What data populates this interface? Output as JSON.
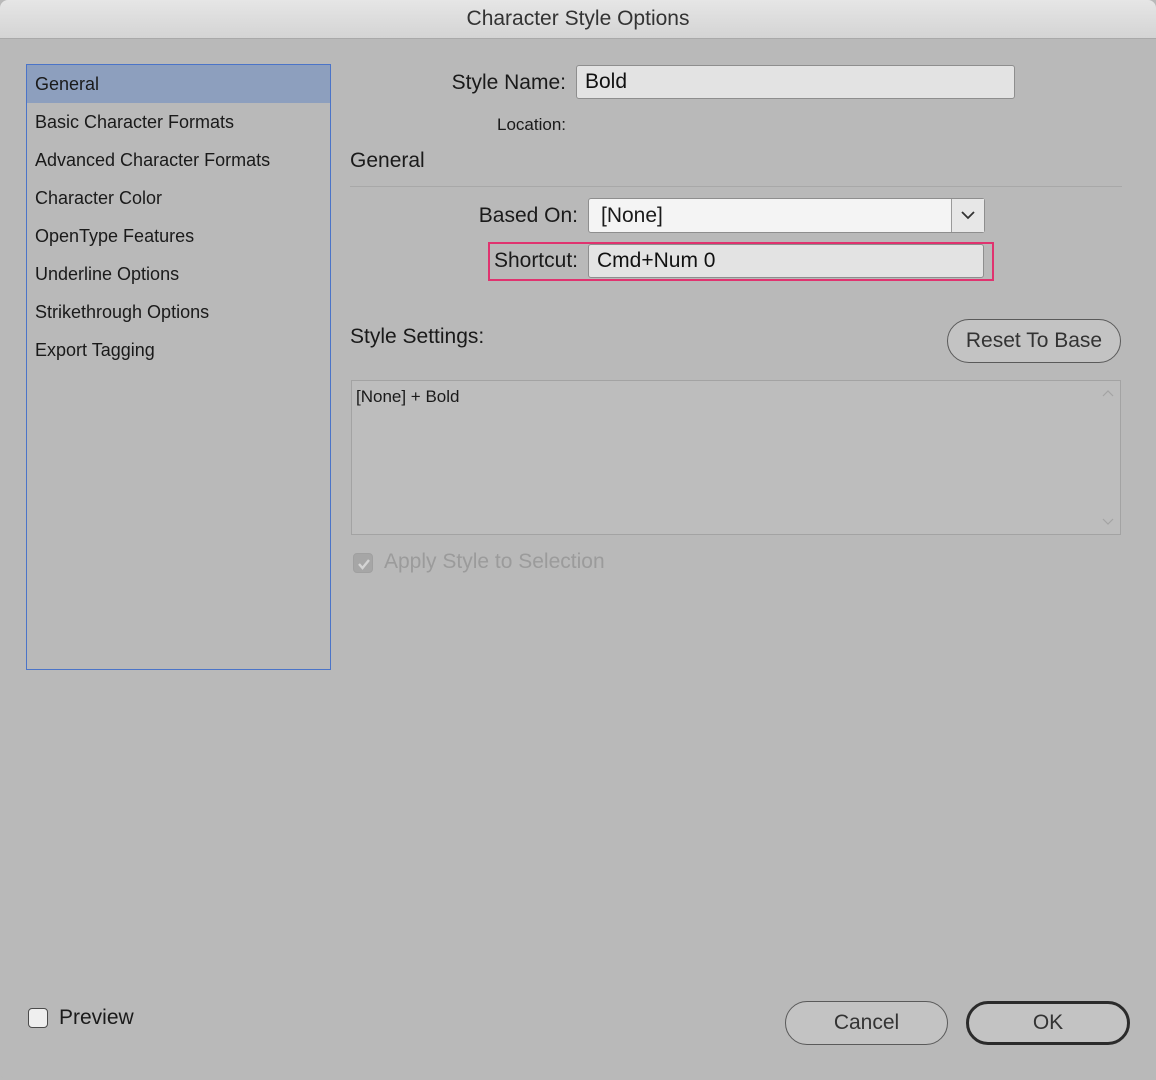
{
  "window": {
    "title": "Character Style Options"
  },
  "sidebar": {
    "items": [
      {
        "label": "General",
        "selected": true
      },
      {
        "label": "Basic Character Formats"
      },
      {
        "label": "Advanced Character Formats"
      },
      {
        "label": "Character Color"
      },
      {
        "label": "OpenType Features"
      },
      {
        "label": "Underline Options"
      },
      {
        "label": "Strikethrough Options"
      },
      {
        "label": "Export Tagging"
      }
    ]
  },
  "form": {
    "style_name_label": "Style Name:",
    "style_name_value": "Bold",
    "location_label": "Location:",
    "section_title": "General",
    "based_on_label": "Based On:",
    "based_on_value": "[None]",
    "shortcut_label": "Shortcut:",
    "shortcut_value": "Cmd+Num 0",
    "style_settings_label": "Style Settings:",
    "reset_button": "Reset To Base",
    "style_settings_text": "[None] + Bold",
    "apply_style_label": "Apply Style to Selection",
    "apply_style_checked": true
  },
  "footer": {
    "preview_label": "Preview",
    "preview_checked": false,
    "cancel_button": "Cancel",
    "ok_button": "OK"
  },
  "colors": {
    "highlight": "#e0336f",
    "selection": "#8d9fbe",
    "list_border": "#4b74c8"
  },
  "icons": {
    "dropdown": "chevron-down-icon",
    "checkbox_checked": "checkmark-icon",
    "scroll_up": "chevron-up-icon",
    "scroll_down": "chevron-down-icon"
  }
}
